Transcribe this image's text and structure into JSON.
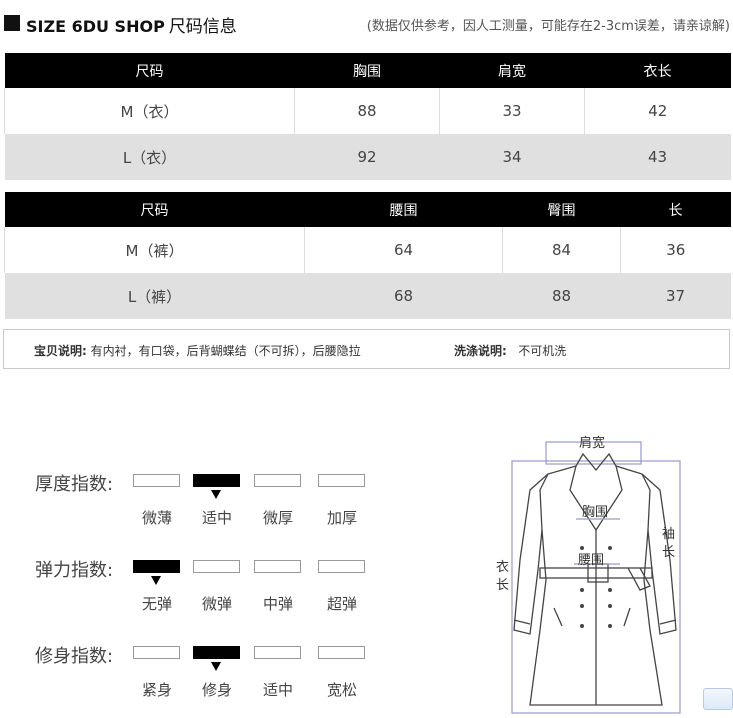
{
  "header": {
    "brand": "SIZE 6DU SHOP",
    "title_cn": "尺码信息",
    "note": "(数据仅供参考，因人工测量，可能存在2-3cm误差，请亲谅解)"
  },
  "top_table": {
    "columns": [
      "尺码",
      "胸围",
      "肩宽",
      "衣长"
    ],
    "rows": [
      [
        "M（衣）",
        "88",
        "33",
        "42"
      ],
      [
        "L（衣）",
        "92",
        "34",
        "43"
      ]
    ]
  },
  "bottom_table": {
    "columns": [
      "尺码",
      "腰围",
      "臀围",
      "长"
    ],
    "rows": [
      [
        "M（裤）",
        "64",
        "84",
        "36"
      ],
      [
        "L（裤）",
        "68",
        "88",
        "37"
      ]
    ]
  },
  "description": {
    "item_label": "宝贝说明:",
    "item_text": "有内衬，有口袋，后背蝴蝶结（不可拆），后腰隐拉",
    "wash_label": "洗涤说明:",
    "wash_text": "不可机洗"
  },
  "scales": [
    {
      "label": "厚度指数:",
      "options": [
        "微薄",
        "适中",
        "微厚",
        "加厚"
      ],
      "selected_index": 1
    },
    {
      "label": "弹力指数:",
      "options": [
        "无弹",
        "微弹",
        "中弹",
        "超弹"
      ],
      "selected_index": 0
    },
    {
      "label": "修身指数:",
      "options": [
        "紧身",
        "修身",
        "适中",
        "宽松"
      ],
      "selected_index": 1
    }
  ],
  "diagram": {
    "shoulder": "肩宽",
    "chest": "胸围",
    "waist": "腰围",
    "sleeve_1": "袖",
    "sleeve_2": "长",
    "length_1": "衣",
    "length_2": "长"
  }
}
